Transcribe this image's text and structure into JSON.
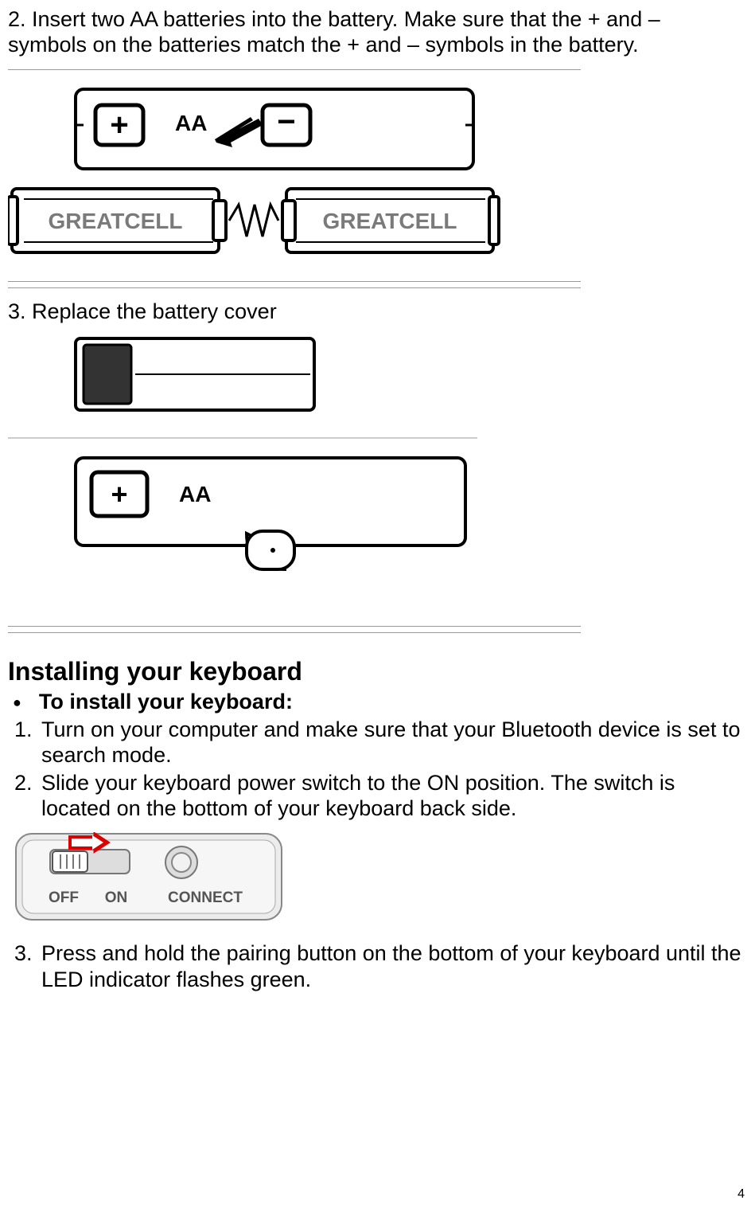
{
  "step2_text": "2. Insert two AA batteries into the battery. Make sure that the + and – symbols on the batteries match the + and – symbols in the battery.",
  "battery_brand": "GREATCELL",
  "battery_size": "AA",
  "step3_text": "3. Replace the battery cover",
  "section_title": "Installing your keyboard",
  "section_bullet": "To install your keyboard:",
  "install_steps": [
    "Turn on your computer and make sure that your Bluetooth device is set to search mode.",
    "Slide your keyboard power switch to the ON position. The switch is located on the bottom of your keyboard back side.",
    "Press and hold the pairing button on the bottom of your keyboard until the LED indicator flashes green."
  ],
  "switch_labels": {
    "off": "OFF",
    "on": "ON",
    "connect": "CONNECT"
  },
  "battery_plus": "+",
  "battery_minus": "−",
  "page_number": "4"
}
